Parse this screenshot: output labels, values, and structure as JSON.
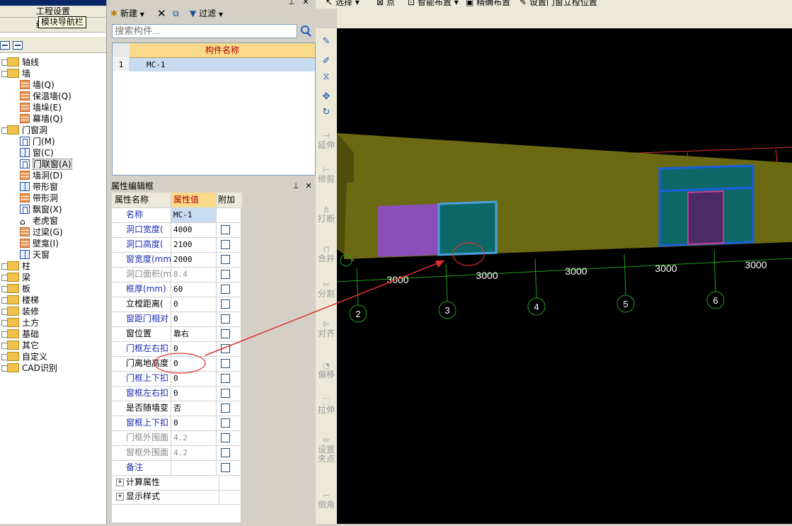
{
  "nav": {
    "menu_items": [
      "工程设置",
      "绘图输入"
    ],
    "tooltip": "模块导航栏",
    "tree": [
      {
        "label": "轴线",
        "level": 0,
        "kind": "folder"
      },
      {
        "label": "墙",
        "level": 0,
        "kind": "folder"
      },
      {
        "label": "墙(Q)",
        "level": 1,
        "kind": "brick"
      },
      {
        "label": "保温墙(Q)",
        "level": 1,
        "kind": "brick"
      },
      {
        "label": "墙垛(E)",
        "level": 1,
        "kind": "brick"
      },
      {
        "label": "幕墙(Q)",
        "level": 1,
        "kind": "brick"
      },
      {
        "label": "门窗洞",
        "level": 0,
        "kind": "folder"
      },
      {
        "label": "门(M)",
        "level": 1,
        "kind": "door"
      },
      {
        "label": "窗(C)",
        "level": 1,
        "kind": "win"
      },
      {
        "label": "门联窗(A)",
        "level": 1,
        "kind": "door",
        "selected": true
      },
      {
        "label": "墙洞(D)",
        "level": 1,
        "kind": "brick"
      },
      {
        "label": "带形窗",
        "level": 1,
        "kind": "win"
      },
      {
        "label": "带形洞",
        "level": 1,
        "kind": "brick"
      },
      {
        "label": "飘窗(X)",
        "level": 1,
        "kind": "door"
      },
      {
        "label": "老虎窗",
        "level": 1,
        "kind": "roof"
      },
      {
        "label": "过梁(G)",
        "level": 1,
        "kind": "brick"
      },
      {
        "label": "壁龛(I)",
        "level": 1,
        "kind": "brick"
      },
      {
        "label": "天窗",
        "level": 1,
        "kind": "win"
      },
      {
        "label": "柱",
        "level": 0,
        "kind": "folder"
      },
      {
        "label": "梁",
        "level": 0,
        "kind": "folder"
      },
      {
        "label": "板",
        "level": 0,
        "kind": "folder"
      },
      {
        "label": "楼梯",
        "level": 0,
        "kind": "folder"
      },
      {
        "label": "装修",
        "level": 0,
        "kind": "folder"
      },
      {
        "label": "土方",
        "level": 0,
        "kind": "folder"
      },
      {
        "label": "基础",
        "level": 0,
        "kind": "folder"
      },
      {
        "label": "其它",
        "level": 0,
        "kind": "folder"
      },
      {
        "label": "自定义",
        "level": 0,
        "kind": "folder"
      },
      {
        "label": "CAD识别",
        "level": 0,
        "kind": "folder"
      }
    ]
  },
  "components": {
    "toolbar": {
      "new_label": "新建",
      "filter_label": "过滤"
    },
    "search_placeholder": "搜索构件...",
    "header": "构件名称",
    "rows": [
      {
        "num": "1",
        "name": "MC-1"
      }
    ]
  },
  "properties": {
    "title": "属性编辑框",
    "headers": [
      "属性名称",
      "属性值",
      "附加"
    ],
    "rows": [
      {
        "name": "名称",
        "value": "MC-1",
        "style": "blue",
        "check": false
      },
      {
        "name": "洞口宽度(",
        "value": "4000",
        "style": "blue",
        "check": true
      },
      {
        "name": "洞口高度(",
        "value": "2100",
        "style": "blue",
        "check": true
      },
      {
        "name": "窗宽度(mm)",
        "value": "2000",
        "style": "blue",
        "check": true
      },
      {
        "name": "洞口面积(m",
        "value": "8.4",
        "style": "gray",
        "check": true
      },
      {
        "name": "框厚(mm)",
        "value": "60",
        "style": "blue",
        "check": true
      },
      {
        "name": "立樘距离(",
        "value": "0",
        "style": "black",
        "check": true
      },
      {
        "name": "窗距门相对",
        "value": "0",
        "style": "blue",
        "check": true
      },
      {
        "name": "窗位置",
        "value": "靠右",
        "style": "black",
        "check": true
      },
      {
        "name": "门框左右扣",
        "value": "0",
        "style": "blue",
        "check": true
      },
      {
        "name": "门离地高度",
        "value": "0",
        "style": "black",
        "check": true
      },
      {
        "name": "门框上下扣",
        "value": "0",
        "style": "blue",
        "check": true
      },
      {
        "name": "窗框左右扣",
        "value": "0",
        "style": "blue",
        "check": true
      },
      {
        "name": "是否随墙变",
        "value": "否",
        "style": "black",
        "check": true
      },
      {
        "name": "窗框上下扣",
        "value": "0",
        "style": "blue",
        "check": true
      },
      {
        "name": "门框外围面",
        "value": "4.2",
        "style": "gray",
        "check": true
      },
      {
        "name": "窗框外围面",
        "value": "4.2",
        "style": "gray",
        "check": true
      },
      {
        "name": "备注",
        "value": "",
        "style": "blue",
        "check": true
      }
    ],
    "groups": [
      "计算属性",
      "显示样式"
    ]
  },
  "top_tools": [
    "选择",
    "点",
    "智能布置",
    "精确布置",
    "设置门窗立樘位置"
  ],
  "side_tools": [
    "延伸",
    "修剪",
    "打断",
    "合并",
    "分割",
    "对齐",
    "偏移",
    "拉伸",
    "设置夹点",
    "倒角"
  ],
  "canvas": {
    "dims": [
      "3000",
      "3000",
      "3000",
      "3000",
      "3000"
    ],
    "axes": [
      "2",
      "3",
      "4",
      "5",
      "6"
    ]
  },
  "colors": {
    "wall": "#6b6a12",
    "opening_teal": "#0f6868",
    "opening_purple": "#8a4fb8",
    "door_purple": "#4b2a66",
    "axis_green": "#1fa01f",
    "annotation_red": "#e03030",
    "selection_blue": "#1a5ee0",
    "title_blue": "#0a246a"
  }
}
